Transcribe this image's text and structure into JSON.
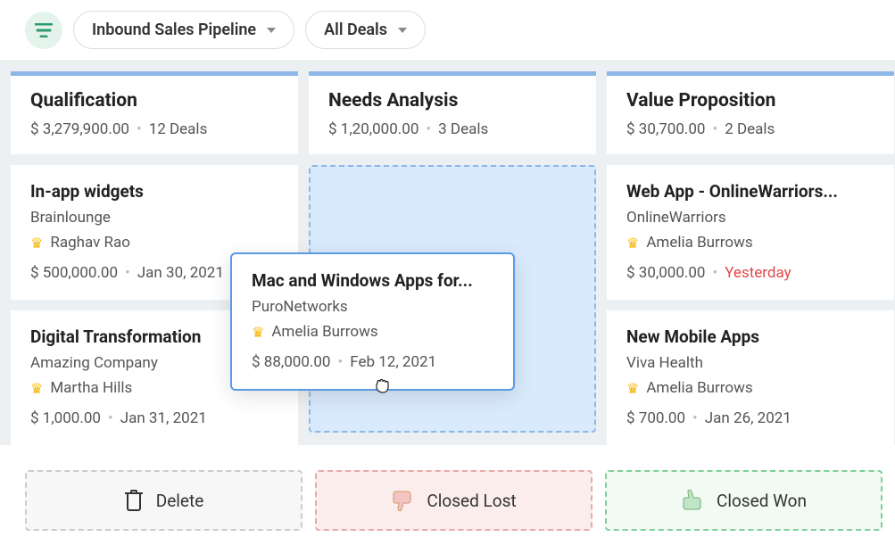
{
  "toolbar": {
    "pipeline_label": "Inbound Sales Pipeline",
    "filter_label": "All Deals"
  },
  "columns": [
    {
      "title": "Qualification",
      "amount": "$ 3,279,900.00",
      "deals": "12 Deals",
      "cards": [
        {
          "title": "In-app widgets",
          "company": "Brainlounge",
          "owner": "Raghav Rao",
          "amount": "$ 500,000.00",
          "date": "Jan 30, 2021",
          "overdue": false
        },
        {
          "title": "Digital Transformation",
          "company": "Amazing Company",
          "owner": "Martha Hills",
          "amount": "$ 1,000.00",
          "date": "Jan 31, 2021",
          "overdue": false
        }
      ]
    },
    {
      "title": "Needs Analysis",
      "amount": "$ 1,20,000.00",
      "deals": "3 Deals",
      "dropzone": true
    },
    {
      "title": "Value Proposition",
      "amount": "$ 30,700.00",
      "deals": "2 Deals",
      "cards": [
        {
          "title": "Web App - OnlineWarriors...",
          "company": "OnlineWarriors",
          "owner": "Amelia Burrows",
          "amount": "$ 30,000.00",
          "date": "Yesterday",
          "overdue": true
        },
        {
          "title": "New Mobile Apps",
          "company": "Viva Health",
          "owner": "Amelia Burrows",
          "amount": "$ 700.00",
          "date": "Jan 26, 2021",
          "overdue": false
        }
      ]
    }
  ],
  "dragging": {
    "title": "Mac and Windows Apps for...",
    "company": "PuroNetworks",
    "owner": "Amelia Burrows",
    "amount": "$ 88,000.00",
    "date": "Feb 12, 2021"
  },
  "actions": {
    "delete": "Delete",
    "lost": "Closed Lost",
    "won": "Closed Won"
  }
}
